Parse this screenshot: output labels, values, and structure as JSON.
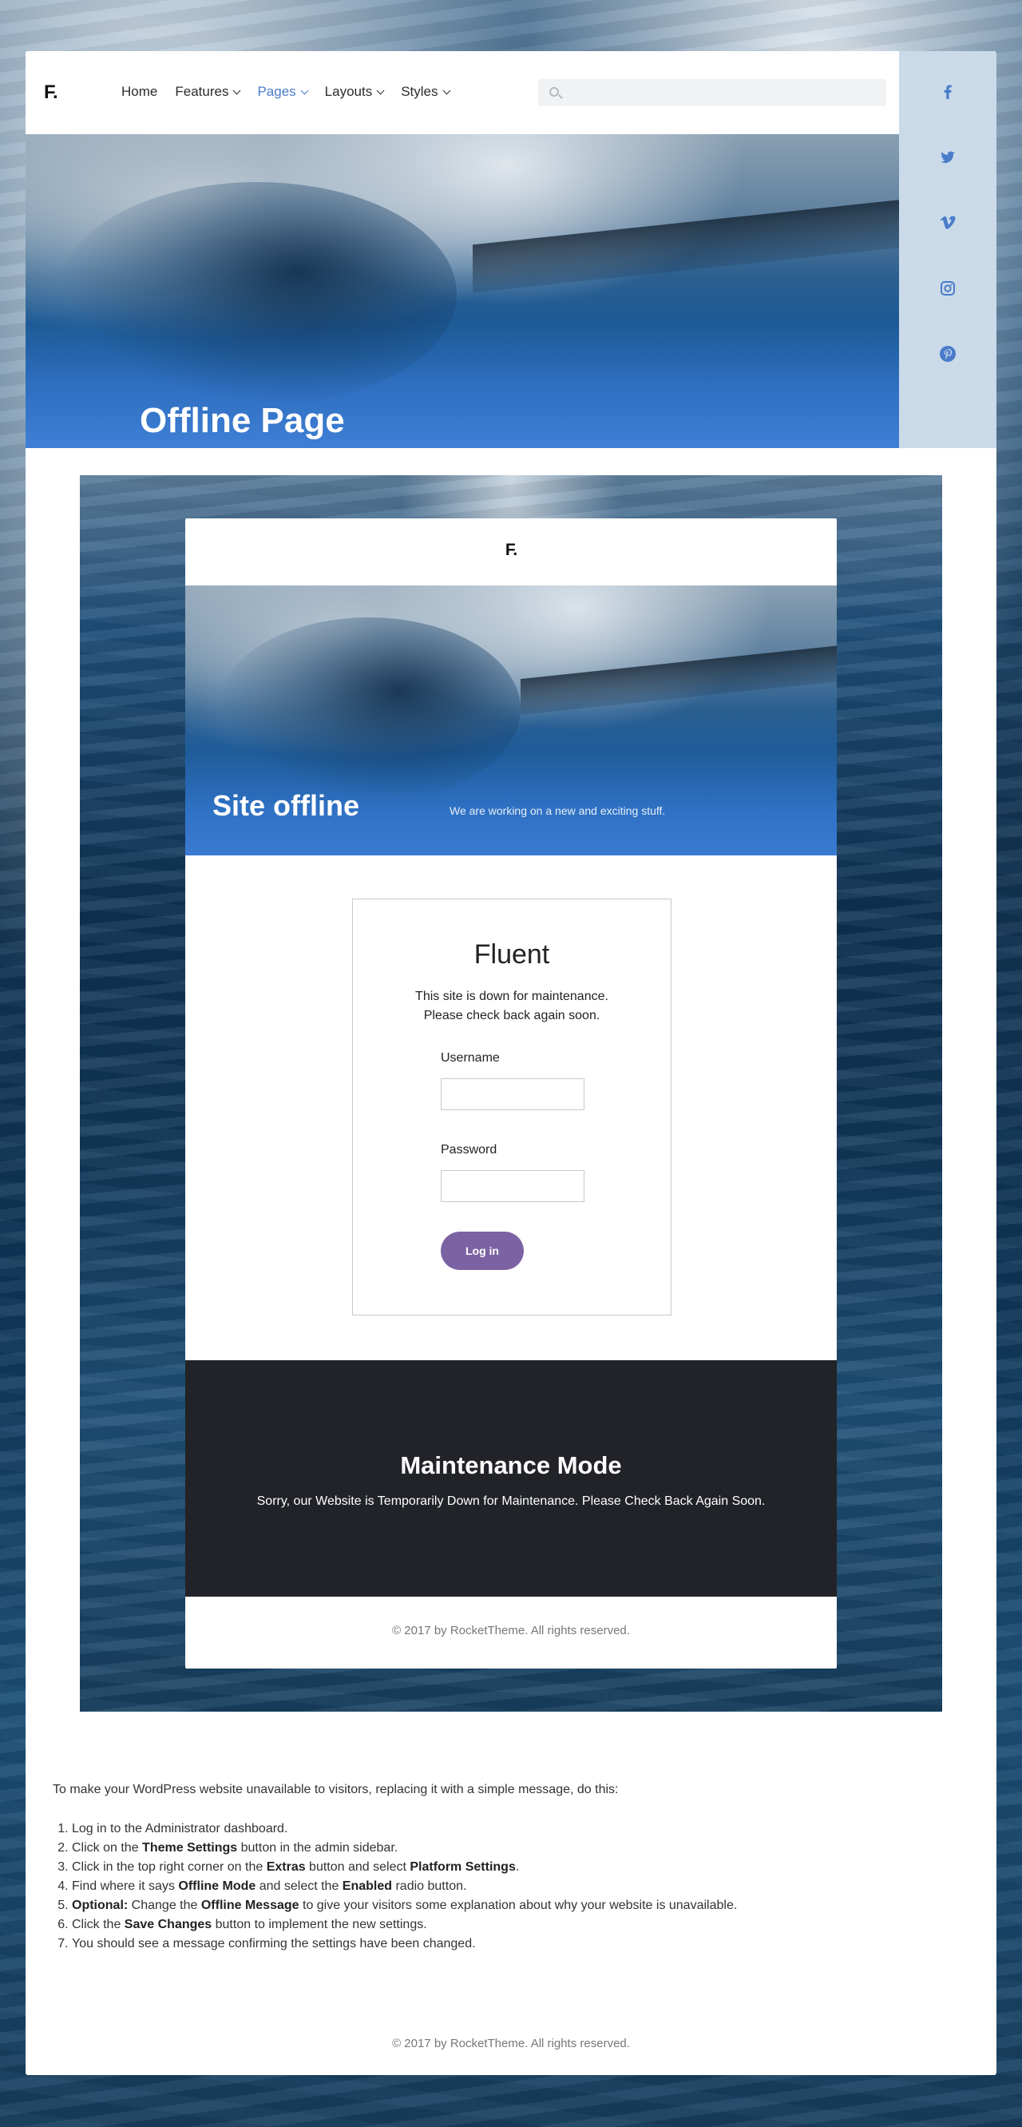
{
  "header": {
    "logo": "F.",
    "nav": [
      {
        "label": "Home",
        "dropdown": false
      },
      {
        "label": "Features",
        "dropdown": true
      },
      {
        "label": "Pages",
        "dropdown": true,
        "active": true
      },
      {
        "label": "Layouts",
        "dropdown": true
      },
      {
        "label": "Styles",
        "dropdown": true
      }
    ],
    "search": {
      "placeholder": ""
    }
  },
  "social": {
    "icons": [
      "facebook-icon",
      "twitter-icon",
      "vimeo-icon",
      "instagram-icon",
      "pinterest-icon"
    ]
  },
  "hero": {
    "title": "Offline Page"
  },
  "offline_card": {
    "logo": "F.",
    "hero_title": "Site offline",
    "hero_subtitle": "We are working on a new and exciting stuff.",
    "login": {
      "title": "Fluent",
      "message_line1": "This site is down for maintenance.",
      "message_line2": "Please check back again soon.",
      "username_label": "Username",
      "username_value": "",
      "password_label": "Password",
      "password_value": "",
      "button_label": "Log in"
    },
    "maintenance": {
      "title": "Maintenance Mode",
      "message": "Sorry, our Website is Temporarily Down for Maintenance. Please Check Back Again Soon."
    },
    "footer": "© 2017 by RocketTheme. All rights reserved."
  },
  "instructions": {
    "intro": "To make your WordPress website unavailable to visitors, replacing it with a simple message, do this:",
    "steps": [
      {
        "parts": [
          {
            "text": "Log in to the Administrator dashboard.",
            "bold": false
          }
        ]
      },
      {
        "parts": [
          {
            "text": "Click on the ",
            "bold": false
          },
          {
            "text": "Theme Settings",
            "bold": true
          },
          {
            "text": " button in the admin sidebar.",
            "bold": false
          }
        ]
      },
      {
        "parts": [
          {
            "text": "Click in the top right corner on the ",
            "bold": false
          },
          {
            "text": "Extras",
            "bold": true
          },
          {
            "text": " button and select ",
            "bold": false
          },
          {
            "text": "Platform Settings",
            "bold": true
          },
          {
            "text": ".",
            "bold": false
          }
        ]
      },
      {
        "parts": [
          {
            "text": "Find where it says ",
            "bold": false
          },
          {
            "text": "Offline Mode",
            "bold": true
          },
          {
            "text": " and select the ",
            "bold": false
          },
          {
            "text": "Enabled",
            "bold": true
          },
          {
            "text": " radio button.",
            "bold": false
          }
        ]
      },
      {
        "parts": [
          {
            "text": "Optional:",
            "bold": true
          },
          {
            "text": " Change the ",
            "bold": false
          },
          {
            "text": "Offline Message",
            "bold": true
          },
          {
            "text": " to give your visitors some explanation about why your website is unavailable.",
            "bold": false
          }
        ]
      },
      {
        "parts": [
          {
            "text": "Click the ",
            "bold": false
          },
          {
            "text": "Save Changes",
            "bold": true
          },
          {
            "text": " button to implement the new settings.",
            "bold": false
          }
        ]
      },
      {
        "parts": [
          {
            "text": "You should see a message confirming the settings have been changed.",
            "bold": false
          }
        ]
      }
    ]
  },
  "footer": "© 2017 by RocketTheme. All rights reserved.",
  "colors": {
    "accent": "#4a7cc9",
    "button": "#7b62a3",
    "dark_section": "#212328"
  }
}
